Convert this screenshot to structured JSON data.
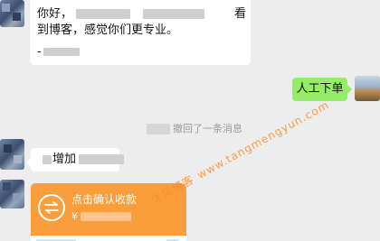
{
  "chat": {
    "msg1": {
      "greeting": "你好，",
      "tail_word": "看",
      "line2": "到博客，感觉你们更专业。",
      "line3": "-"
    },
    "my_msg": {
      "text": "人工下单"
    },
    "system_notice": {
      "text": "撤回了一条消息"
    },
    "msg2": {
      "text": "增加"
    },
    "transfer": {
      "title": "点击确认收款",
      "currency_symbol": "¥",
      "icon": "transfer-arrows-icon",
      "accent_color": "#fa9d3b"
    },
    "colors": {
      "my_bubble": "#95ec69",
      "background": "#ededed"
    }
  },
  "watermark": {
    "name": "沐风博客",
    "site": "www.tangmengyun.com"
  }
}
